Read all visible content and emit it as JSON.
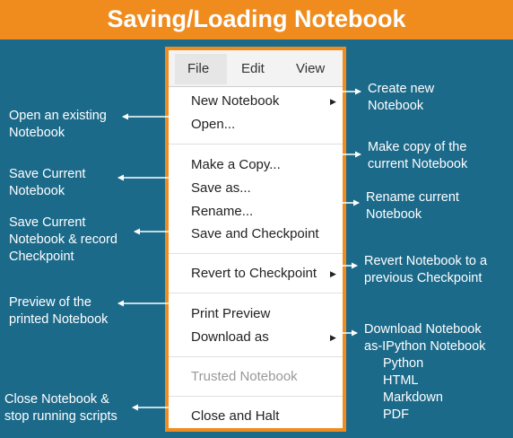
{
  "banner": {
    "title": "Saving/Loading Notebook"
  },
  "menu": {
    "tabs": [
      "File",
      "Edit",
      "View"
    ],
    "items": [
      "New Notebook",
      "Open...",
      "Make a Copy...",
      "Save as...",
      "Rename...",
      "Save and Checkpoint",
      "Revert to Checkpoint",
      "Print Preview",
      "Download as",
      "Trusted Notebook",
      "Close and Halt"
    ]
  },
  "left_notes": {
    "open": [
      "Open an existing",
      "Notebook"
    ],
    "save": [
      "Save Current",
      "Notebook"
    ],
    "checkpoint": [
      "Save Current",
      "Notebook & record",
      "Checkpoint"
    ],
    "preview": [
      "Preview of the",
      "printed Notebook"
    ],
    "close": [
      "Close Notebook &",
      "stop running scripts"
    ]
  },
  "right_notes": {
    "create": [
      "Create new",
      "Notebook"
    ],
    "copy": [
      "Make copy  of the",
      "current  Notebook"
    ],
    "rename": [
      "Rename current",
      "Notebook"
    ],
    "revert": [
      "Revert Notebook to a",
      "previous Checkpoint"
    ],
    "download": [
      "Download Notebook",
      "as-IPython  Notebook",
      "Python",
      "HTML",
      "Markdown",
      "PDF"
    ]
  },
  "colors": {
    "background": "#1c6a8a",
    "accent": "#f08c1e",
    "arrow": "#ffffff"
  },
  "icons": {
    "submenu": "triangle-right-icon"
  }
}
